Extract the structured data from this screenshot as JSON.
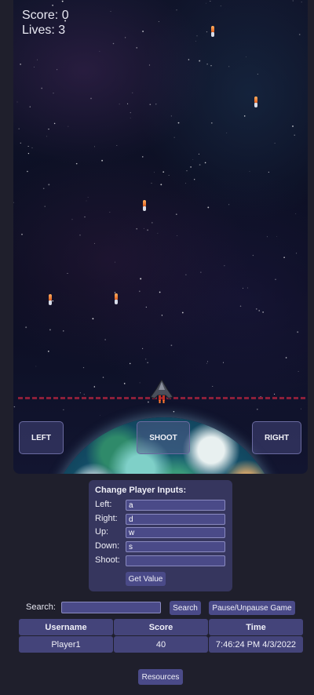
{
  "hud": {
    "score_label": "Score: 0",
    "lives_label": "Lives: 3"
  },
  "controls": {
    "left": "LEFT",
    "shoot": "SHOOT",
    "right": "RIGHT"
  },
  "inputs_panel": {
    "title": "Change Player Inputs:",
    "fields": [
      {
        "label": "Left:",
        "value": "a"
      },
      {
        "label": "Right:",
        "value": "d"
      },
      {
        "label": "Up:",
        "value": "w"
      },
      {
        "label": "Down:",
        "value": "s"
      },
      {
        "label": "Shoot:",
        "value": ""
      }
    ],
    "get_value_button": "Get Value"
  },
  "search": {
    "label": "Search:",
    "value": "",
    "search_button": "Search",
    "pause_button": "Pause/Unpause Game"
  },
  "scoreboard": {
    "headers": [
      "Username",
      "Score",
      "Time"
    ],
    "rows": [
      [
        "Player1",
        "40",
        "7:46:24 PM 4/3/2022"
      ]
    ]
  },
  "resources_button": "Resources",
  "colors": {
    "background": "#1f1f2c",
    "panel": "#36365e",
    "button": "#4a4a88",
    "danger_line": "#8c1f3a"
  },
  "icons": {
    "player": "spaceship-icon",
    "enemy": "missile-icon",
    "planet": "earth-planet"
  }
}
